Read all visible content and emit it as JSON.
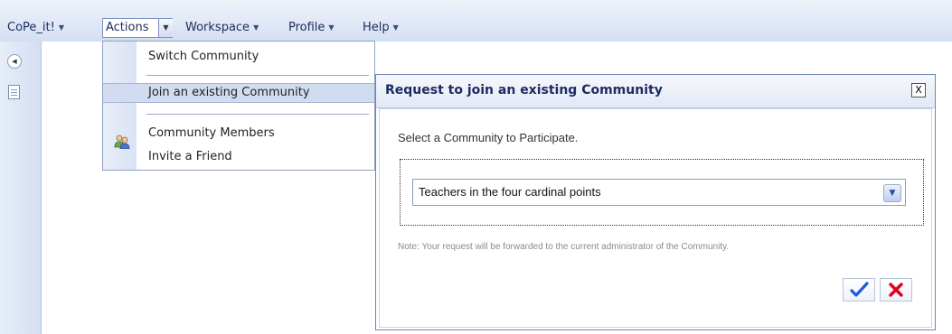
{
  "menubar": {
    "items": [
      {
        "label": "CoPe_it!"
      },
      {
        "label": "Actions"
      },
      {
        "label": "Workspace"
      },
      {
        "label": "Profile"
      },
      {
        "label": "Help"
      }
    ]
  },
  "dropdown": {
    "switch_community": "Switch Community",
    "join_existing": "Join an existing Community",
    "community_members": "Community Members",
    "invite_friend": "Invite a Friend"
  },
  "dialog": {
    "title": "Request to join an existing Community",
    "close_label": "X",
    "prompt": "Select a Community to Participate.",
    "selected_community": "Teachers in the four cardinal points",
    "note": "Note: Your request will be forwarded to the current administrator of the Community."
  },
  "colors": {
    "accent": "#1f2c63",
    "ok": "#1f5bd6",
    "cancel": "#e0001a"
  },
  "icons": {
    "collapse": "collapse-arrow-icon",
    "page": "page-icon",
    "members": "users-icon",
    "ok": "checkmark-icon",
    "cancel": "x-icon"
  }
}
